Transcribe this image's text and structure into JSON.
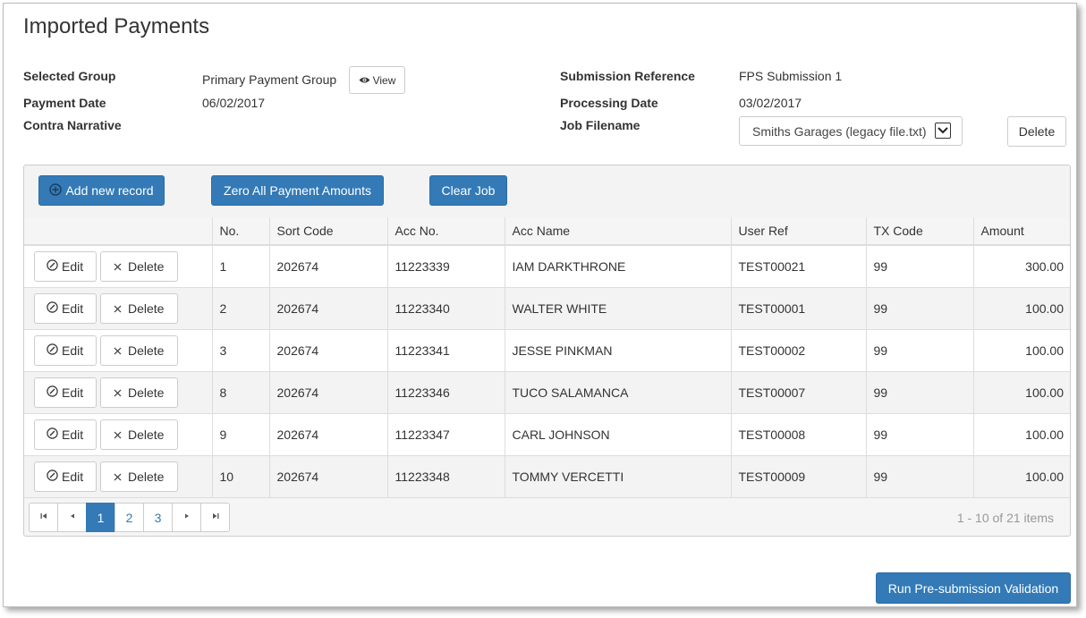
{
  "page": {
    "title": "Imported Payments"
  },
  "details": {
    "selected_group_label": "Selected Group",
    "selected_group_value": "Primary Payment Group",
    "view_button": "View",
    "payment_date_label": "Payment Date",
    "payment_date_value": "06/02/2017",
    "contra_narrative_label": "Contra Narrative",
    "submission_reference_label": "Submission Reference",
    "submission_reference_value": "FPS Submission 1",
    "processing_date_label": "Processing Date",
    "processing_date_value": "03/02/2017",
    "job_filename_label": "Job Filename",
    "job_filename_value": "Smiths Garages (legacy file.txt)",
    "delete_button": "Delete"
  },
  "toolbar": {
    "add_record": "Add new record",
    "zero_amounts": "Zero All Payment Amounts",
    "clear_job": "Clear Job"
  },
  "table": {
    "columns": [
      "No.",
      "Sort Code",
      "Acc No.",
      "Acc Name",
      "User Ref",
      "TX Code",
      "Amount"
    ],
    "edit_label": "Edit",
    "delete_label": "Delete",
    "rows": [
      {
        "no": "1",
        "sort_code": "202674",
        "acc_no": "11223339",
        "acc_name": "IAM DARKTHRONE",
        "user_ref": "TEST00021",
        "tx_code": "99",
        "amount": "300.00"
      },
      {
        "no": "2",
        "sort_code": "202674",
        "acc_no": "11223340",
        "acc_name": "WALTER WHITE",
        "user_ref": "TEST00001",
        "tx_code": "99",
        "amount": "100.00"
      },
      {
        "no": "3",
        "sort_code": "202674",
        "acc_no": "11223341",
        "acc_name": "JESSE PINKMAN",
        "user_ref": "TEST00002",
        "tx_code": "99",
        "amount": "100.00"
      },
      {
        "no": "8",
        "sort_code": "202674",
        "acc_no": "11223346",
        "acc_name": "TUCO SALAMANCA",
        "user_ref": "TEST00007",
        "tx_code": "99",
        "amount": "100.00"
      },
      {
        "no": "9",
        "sort_code": "202674",
        "acc_no": "11223347",
        "acc_name": "CARL JOHNSON",
        "user_ref": "TEST00008",
        "tx_code": "99",
        "amount": "100.00"
      },
      {
        "no": "10",
        "sort_code": "202674",
        "acc_no": "11223348",
        "acc_name": "TOMMY VERCETTI",
        "user_ref": "TEST00009",
        "tx_code": "99",
        "amount": "100.00"
      }
    ]
  },
  "pager": {
    "pages": [
      "1",
      "2",
      "3"
    ],
    "active_page": "1",
    "info": "1 - 10 of 21 items"
  },
  "actions": {
    "run_validation": "Run Pre-submission Validation"
  },
  "colors": {
    "primary": "#337ab7",
    "border": "#cccccc",
    "alt_row": "#f3f3f3"
  },
  "icons": {
    "view": "eye-icon",
    "add": "plus-circle-icon",
    "edit": "pencil-circle-icon",
    "delete": "x-icon",
    "first": "first-page-icon",
    "prev": "prev-page-icon",
    "next": "next-page-icon",
    "last": "last-page-icon",
    "dropdown": "chevron-down-icon"
  }
}
